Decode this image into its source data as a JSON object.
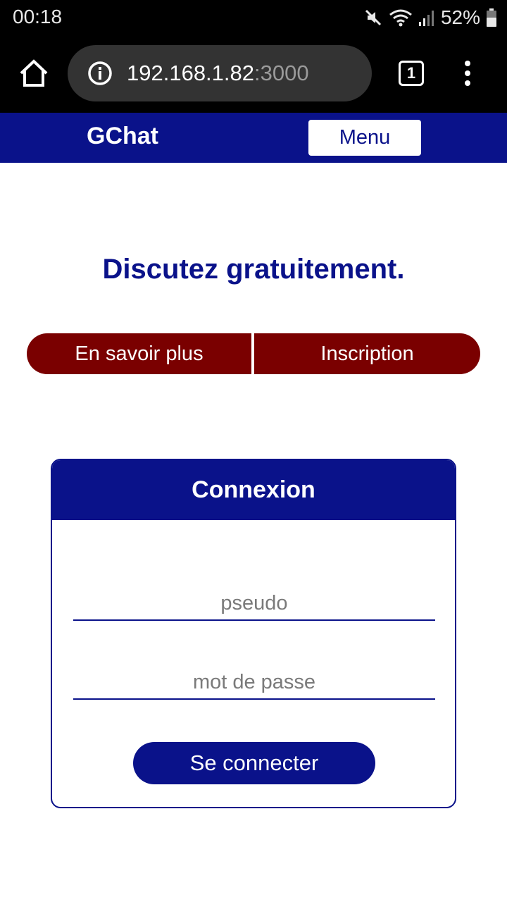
{
  "status_bar": {
    "time": "00:18",
    "battery": "52%",
    "icons": [
      "mute-icon",
      "wifi-icon",
      "signal-icon",
      "battery-icon"
    ]
  },
  "browser": {
    "url_host": "192.168.1.82",
    "url_port": ":3000",
    "tab_count": "1",
    "icons": [
      "home-icon",
      "info-icon",
      "tabs-icon",
      "more-vert-icon"
    ]
  },
  "header": {
    "brand": "GChat",
    "menu_label": "Menu",
    "color": "#0a128a"
  },
  "hero": {
    "title": "Discutez gratuitement.",
    "learn_more_label": "En savoir plus",
    "signup_label": "Inscription",
    "button_color": "#7a0000"
  },
  "login": {
    "title": "Connexion",
    "username_placeholder": "pseudo",
    "password_placeholder": "mot de passe",
    "submit_label": "Se connecter"
  }
}
